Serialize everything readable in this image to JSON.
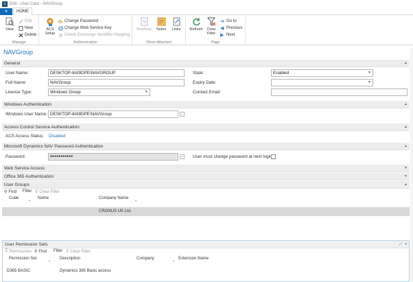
{
  "window": {
    "title": "Edit - User Card - NAVGroup"
  },
  "ribbon": {
    "file_label": "▾",
    "tab_home": "HOME",
    "groups": {
      "manage": {
        "label": "Manage",
        "view": "View",
        "edit": "Edit",
        "new": "New",
        "delete": "Delete"
      },
      "authentication": {
        "label": "Authentication",
        "acs_setup_1": "ACS",
        "acs_setup_2": "Setup",
        "change_password": "Change Password",
        "change_web_service_key": "Change Web Service Key",
        "delete_exchange_id": "Delete Exchange Identifier Mapping"
      },
      "show_attached": {
        "label": "Show Attached",
        "onenote": "OneNote",
        "notes": "Notes",
        "links": "Links"
      },
      "page": {
        "label": "Page",
        "refresh": "Refresh",
        "clear_filter_1": "Clear",
        "clear_filter_2": "Filter",
        "goto": "Go to",
        "previous": "Previous",
        "next": "Next"
      }
    }
  },
  "page": {
    "title": "NAVGroup"
  },
  "general": {
    "header": "General",
    "user_name_label": "User Name:",
    "user_name": "DESKTOP-8AI9DPE\\NAVGROUP",
    "full_name_label": "Full Name:",
    "full_name": "NAVGroup",
    "license_type_label": "License Type:",
    "license_type": "Windows Group",
    "state_label": "State:",
    "state": "Enabled",
    "expiry_label": "Expiry Date:",
    "expiry": "",
    "contact_email_label": "Contact Email:",
    "contact_email": ""
  },
  "windows_auth": {
    "header": "Windows Authentication",
    "user_name_label": "Windows User Name:",
    "user_name": "DESKTOP-8AI9DPE\\NAVGroup"
  },
  "acs_auth": {
    "header": "Access Control Service Authentication",
    "status_label": "ACS Access Status:",
    "status": "Disabled"
  },
  "nav_password": {
    "header": "Microsoft Dynamics NAV Password Authentication",
    "password_label": "Password:",
    "password": "●●●●●●●●●●●",
    "must_change_label": "User must change password at next login:"
  },
  "web_service": {
    "header": "Web Service Access"
  },
  "office365": {
    "header": "Office 365 Authentication"
  },
  "user_groups": {
    "header": "User Groups",
    "find": "Find",
    "filter": "Filter",
    "clear_filter": "Clear Filter",
    "columns": [
      "Code",
      "Name",
      "Company Name"
    ],
    "rows": [
      {
        "code": "",
        "name": "",
        "company": "CRONUS UK Ltd."
      }
    ]
  },
  "user_permission_sets": {
    "header": "User Permission Sets",
    "permissions": "Permissions",
    "find": "Find",
    "filter": "Filter",
    "clear_filter": "Clear Filter",
    "columns": [
      "Permission Set",
      "Description",
      "Company",
      "Extension Name"
    ],
    "rows": [
      {
        "permission_set": "D365 BASIC",
        "description": "Dynamics 365 Basic access",
        "company": "",
        "extension": ""
      }
    ]
  },
  "colors": {
    "accent": "#1a72b8",
    "file_tab": "#0e6ab8",
    "section_bg": "#ededed"
  }
}
